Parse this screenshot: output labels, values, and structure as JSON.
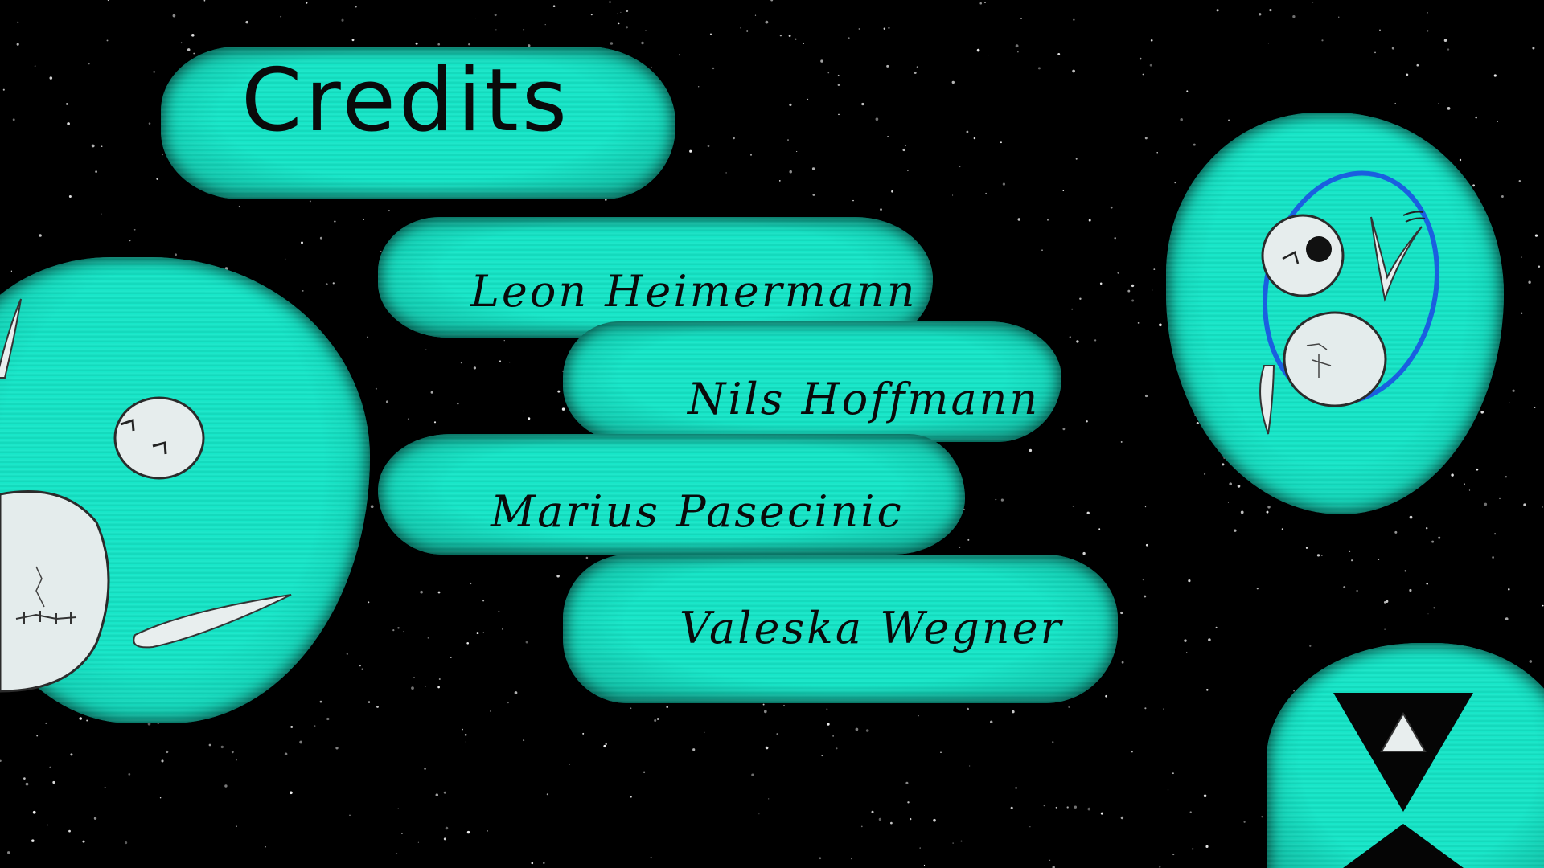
{
  "screen": {
    "title": "Credits"
  },
  "credits": [
    "Leon Heimermann",
    "Nils Hoffmann",
    "Marius Pasecinic",
    "Valeska Wegner"
  ],
  "colors": {
    "background": "#000000",
    "brush_teal": "#16e6c8",
    "text": "#0a0a0a",
    "ring_blue": "#1a5fe0",
    "moon_white": "#e8eeee"
  },
  "icons": {
    "back_button": "hourglass-triangle-icon"
  }
}
